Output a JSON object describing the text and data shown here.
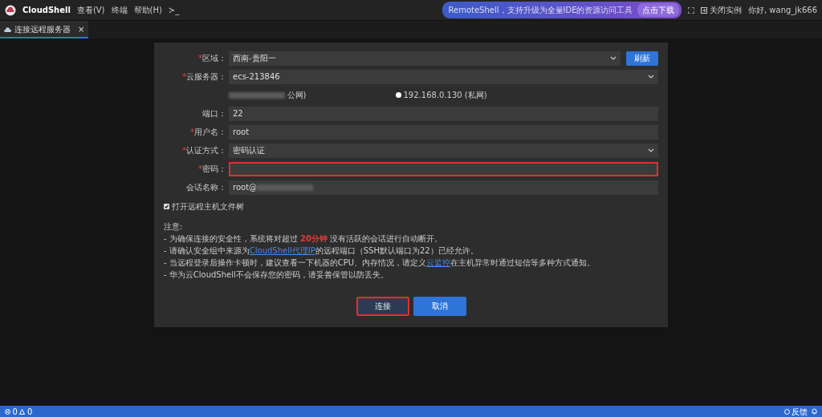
{
  "topbar": {
    "brand": "CloudShell",
    "menus": [
      "查看(V)",
      "终端",
      "帮助(H)"
    ],
    "terminal_glyph": "≻_",
    "promo": {
      "text": "RemoteShell，支持升级为全量IDE的资源访问工具",
      "action": "点击下载"
    },
    "close_instance": "关闭实例",
    "greeting": "你好, wang_jk666"
  },
  "tabs": [
    {
      "label": "连接远程服务器",
      "selected": true,
      "close_glyph": "×"
    }
  ],
  "form": {
    "required_mark": "*",
    "rows": [
      {
        "kind": "select",
        "label": "区域：",
        "required": true,
        "value": "西南-贵阳一",
        "button": "刷新"
      },
      {
        "kind": "select",
        "label": "云服务器：",
        "required": true,
        "value": "ecs-213846"
      },
      {
        "kind": "radios",
        "options": [
          {
            "text": "公网)",
            "redacted": true
          },
          {
            "text": "192.168.0.130 (私网)",
            "selected": false
          }
        ]
      },
      {
        "kind": "input",
        "label": "端口：",
        "required": false,
        "value": "22"
      },
      {
        "kind": "input",
        "label": "用户名：",
        "required": true,
        "value": "root"
      },
      {
        "kind": "select",
        "label": "认证方式：",
        "required": true,
        "value": "密码认证"
      },
      {
        "kind": "input",
        "label": "密码：",
        "required": true,
        "value": "",
        "highlighted": true
      },
      {
        "kind": "input",
        "label": "会话名称：",
        "required": false,
        "value": "root@",
        "redacted": true
      }
    ],
    "checkbox": {
      "label": "打开远程主机文件树",
      "checked": true
    },
    "notes_title": "注意:",
    "notes": [
      [
        {
          "kind": "text",
          "text": "- 为确保连接的安全性，系统将对超过 "
        },
        {
          "kind": "alert",
          "text": "20分钟"
        },
        {
          "kind": "text",
          "text": " 没有活跃的会话进行自动断开。"
        }
      ],
      [
        {
          "kind": "text",
          "text": "- 请确认安全组中来源为"
        },
        {
          "kind": "link",
          "text": "CloudShell代理IP"
        },
        {
          "kind": "text",
          "text": "的远程端口（SSH默认端口为22）已经允许。"
        }
      ],
      [
        {
          "kind": "text",
          "text": "- 当远程登录后操作卡顿时，建议查看一下机器的CPU、内存情况，请定义"
        },
        {
          "kind": "link",
          "text": "云监控"
        },
        {
          "kind": "text",
          "text": "在主机异常时通过短信等多种方式通知。"
        }
      ],
      [
        {
          "kind": "text",
          "text": "- 华为云CloudShell不会保存您的密码，请妥善保管以防丢失。"
        }
      ]
    ],
    "buttons": [
      {
        "label": "连接",
        "disabled": true,
        "highlighted": true
      },
      {
        "label": "取消",
        "disabled": false,
        "highlighted": false
      }
    ]
  },
  "status_bar": {
    "errors": "0",
    "warnings": "0",
    "feedback": "反馈"
  }
}
